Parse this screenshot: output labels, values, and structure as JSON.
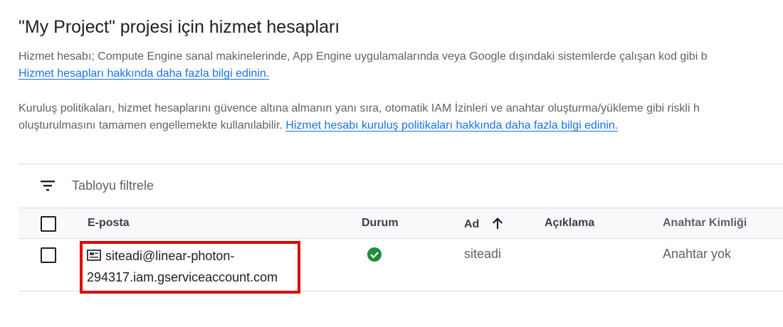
{
  "page": {
    "title": "\"My Project\" projesi için hizmet hesapları",
    "para1_text": "Hizmet hesabı; Compute Engine sanal makinelerinde, App Engine uygulamalarında veya Google dışındaki sistemlerde çalışan kod gibi b",
    "para1_link": "Hizmet hesapları hakkında daha fazla bilgi edinin.",
    "para2_line1": "Kuruluş politikaları, hizmet hesaplarını güvence altına almanın yanı sıra, otomatik IAM İzinleri ve anahtar oluşturma/yükleme gibi riskli h",
    "para2_line2": "oluşturulmasını tamamen engellemekte kullanılabilir.",
    "para2_link": "Hizmet hesabı kuruluş politikaları hakkında daha fazla bilgi edinin."
  },
  "filter": {
    "placeholder": "Tabloyu filtrele",
    "icon": "filter-list-icon"
  },
  "table": {
    "columns": {
      "email": "E-posta",
      "status": "Durum",
      "name": "Ad",
      "description": "Açıklama",
      "key_id": "Anahtar Kimliği"
    },
    "sort_icon": "arrow-upward-icon",
    "rows": [
      {
        "email_line1": "siteadi@linear-photon-",
        "email_line2": "294317.iam.gserviceaccount.com",
        "email_icon": "service-account-icon",
        "status_icon": "check-circle-icon",
        "status_color": "#1e8e3e",
        "name": "siteadi",
        "description": "",
        "key_id": "Anahtar yok"
      }
    ]
  },
  "colors": {
    "link": "#1a73e8",
    "highlight_border": "#e00000"
  }
}
